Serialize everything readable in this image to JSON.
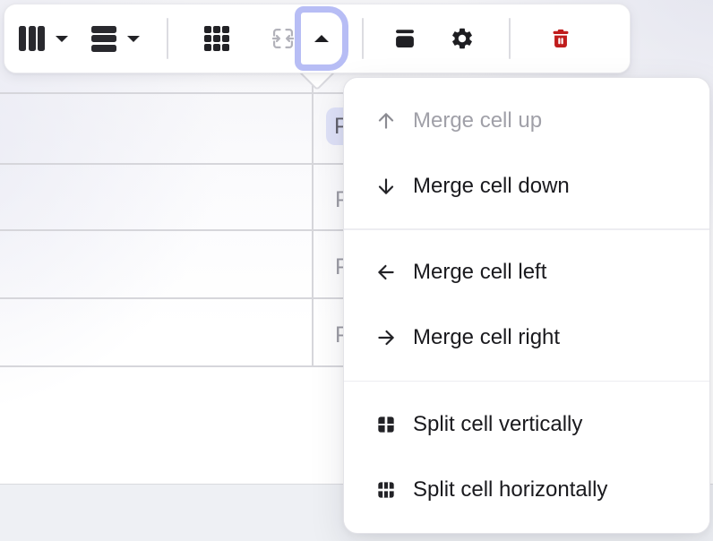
{
  "colors": {
    "accent_ring": "#b7bdf5",
    "selection_highlight": "#dfe2f8",
    "danger": "#c01c1c",
    "table_line": "#d6d6db",
    "menu_divider": "#ededf1",
    "page_bg": "#eef0f4"
  },
  "toolbar": {
    "buttons": [
      {
        "name": "columns",
        "icon": "columns-icon",
        "has_caret": true
      },
      {
        "name": "rows",
        "icon": "rows-icon",
        "has_caret": true
      },
      {
        "name": "table-grid",
        "icon": "table-grid-icon"
      },
      {
        "name": "merge-cells",
        "icon": "merge-cells-icon",
        "state": "disabled"
      },
      {
        "name": "merge-split-menu",
        "icon": "caret-up-icon",
        "state": "open"
      },
      {
        "name": "header-row",
        "icon": "header-row-icon"
      },
      {
        "name": "settings",
        "icon": "gear-icon"
      },
      {
        "name": "delete-table",
        "icon": "trash-icon"
      }
    ]
  },
  "menu": {
    "sections": [
      {
        "items": [
          {
            "icon": "arrow-up-icon",
            "label": "Merge cell up",
            "disabled": true
          },
          {
            "icon": "arrow-down-icon",
            "label": "Merge cell down",
            "disabled": false
          }
        ]
      },
      {
        "items": [
          {
            "icon": "arrow-left-icon",
            "label": "Merge cell left",
            "disabled": false
          },
          {
            "icon": "arrow-right-icon",
            "label": "Merge cell right",
            "disabled": false
          }
        ]
      },
      {
        "items": [
          {
            "icon": "split-vertical-icon",
            "label": "Split cell vertically",
            "disabled": false
          },
          {
            "icon": "split-horizontal-icon",
            "label": "Split cell horizontally",
            "disabled": false
          }
        ]
      }
    ]
  },
  "table": {
    "selected_cell_fragment": "P",
    "row_fragments": [
      "P",
      "P",
      "P"
    ]
  }
}
